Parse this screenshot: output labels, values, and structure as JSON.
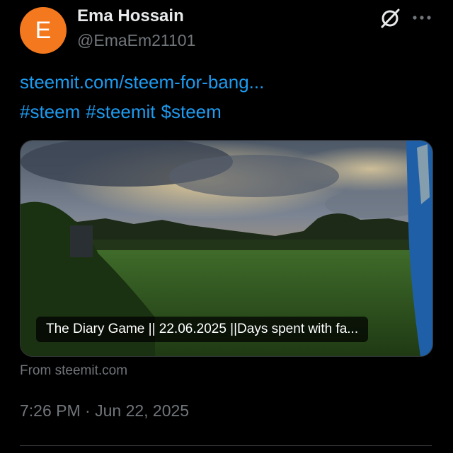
{
  "author": {
    "avatar_letter": "E",
    "avatar_color": "#f4781e",
    "name": "Ema Hossain",
    "handle": "@EmaEm21101"
  },
  "header_icons": [
    "grok-slash-icon",
    "more-options-icon"
  ],
  "post": {
    "link_text": "steemit.com/steem-for-bang...",
    "hashtags": [
      "#steem",
      "#steemit",
      "$steem"
    ]
  },
  "link_card": {
    "title": "The Diary Game || 22.06.2025 ||Days spent with fa...",
    "source": "From steemit.com"
  },
  "timestamp": "7:26 PM · Jun 22, 2025",
  "colors": {
    "background": "#000000",
    "link_blue": "#1d9bf0",
    "secondary_text": "#71767b",
    "primary_text": "#e7e9ea"
  }
}
